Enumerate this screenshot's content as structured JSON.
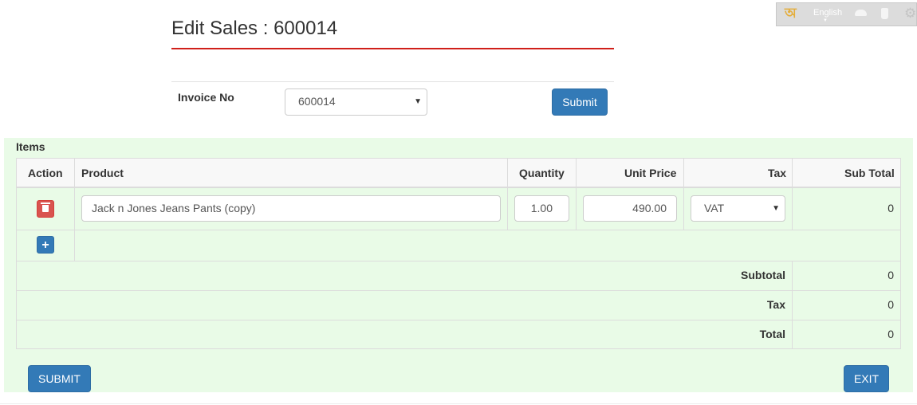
{
  "toolbar": {
    "logo_glyph": "অ",
    "language": "English",
    "icons": [
      "bangla-logo-icon",
      "cloud-icon",
      "bottle-icon",
      "gear-icon"
    ]
  },
  "header": {
    "title": "Edit Sales : 600014"
  },
  "invoice": {
    "label": "Invoice No",
    "selected": "600014",
    "submit_label": "Submit"
  },
  "items": {
    "section_label": "Items",
    "columns": [
      "Action",
      "Product",
      "Quantity",
      "Unit Price",
      "Tax",
      "Sub Total"
    ],
    "rows": [
      {
        "product": "Jack n Jones Jeans Pants (copy)",
        "quantity": "1.00",
        "unit_price": "490.00",
        "tax": "VAT",
        "sub_total": "0"
      }
    ]
  },
  "totals": {
    "subtotal_label": "Subtotal",
    "subtotal_value": "0",
    "tax_label": "Tax",
    "tax_value": "0",
    "total_label": "Total",
    "total_value": "0"
  },
  "actions": {
    "submit_label": "SUBMIT",
    "exit_label": "EXIT"
  },
  "colors": {
    "accent": "#337ab7",
    "danger": "#d9534f",
    "title_rule": "#d0201a",
    "panel_bg": "#e9fbe7"
  }
}
